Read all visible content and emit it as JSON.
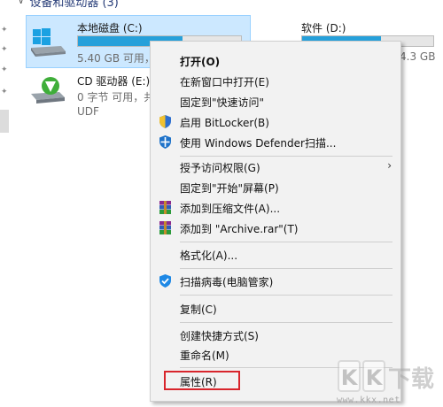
{
  "section": {
    "title": "设备和驱动器 (3)"
  },
  "drives": [
    {
      "name": "本地磁盘 (C:)",
      "sub": "5.40 GB 可用，共",
      "usage": 0.78
    },
    {
      "name": "软件 (D:)",
      "sub": "4.3 GB",
      "usage": 0.6
    },
    {
      "name": "CD 驱动器 (E:)",
      "sub": "0 字节 可用，共",
      "fs": "UDF"
    }
  ],
  "menu": {
    "items": [
      {
        "label": "打开(O)",
        "bold": true
      },
      {
        "label": "在新窗口中打开(E)"
      },
      {
        "label": "固定到\"快速访问\""
      },
      {
        "label": "启用 BitLocker(B)",
        "icon": "bitlocker-shield-icon"
      },
      {
        "label": "使用 Windows Defender扫描...",
        "icon": "windows-defender-icon"
      },
      {
        "label": "授予访问权限(G)",
        "submenu": "›"
      },
      {
        "label": "固定到\"开始\"屏幕(P)"
      },
      {
        "label": "添加到压缩文件(A)...",
        "icon": "winrar-icon"
      },
      {
        "label": "添加到 \"Archive.rar\"(T)",
        "icon": "winrar-icon"
      },
      {
        "label": "格式化(A)..."
      },
      {
        "label": "扫描病毒(电脑管家)",
        "icon": "tencent-pc-manager-icon"
      },
      {
        "label": "复制(C)"
      },
      {
        "label": "创建快捷方式(S)"
      },
      {
        "label": "重命名(M)"
      },
      {
        "label": "属性(R)"
      }
    ]
  },
  "watermark": {
    "logo_text": "KK下载",
    "url": "www.kkx.net"
  },
  "colors": {
    "accent": "#26a0da",
    "selection": "#cce8ff",
    "highlight_box": "#d8252c"
  }
}
